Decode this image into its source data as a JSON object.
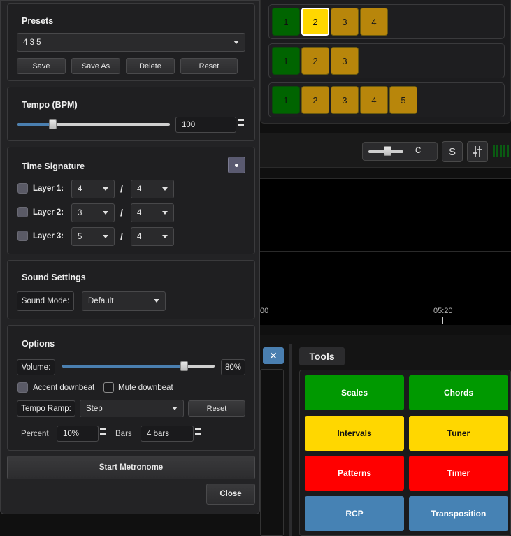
{
  "background": {
    "beat_rows": [
      {
        "beats": [
          {
            "label": "1",
            "state": "green"
          },
          {
            "label": "2",
            "state": "active"
          },
          {
            "label": "3",
            "state": "normal"
          },
          {
            "label": "4",
            "state": "normal"
          }
        ]
      },
      {
        "beats": [
          {
            "label": "1",
            "state": "green"
          },
          {
            "label": "2",
            "state": "normal"
          },
          {
            "label": "3",
            "state": "normal"
          }
        ]
      },
      {
        "beats": [
          {
            "label": "1",
            "state": "green"
          },
          {
            "label": "2",
            "state": "normal"
          },
          {
            "label": "3",
            "state": "normal"
          },
          {
            "label": "4",
            "state": "normal"
          },
          {
            "label": "5",
            "state": "normal"
          }
        ]
      }
    ],
    "mini_slider_label": "C",
    "s_button": "S",
    "mixer_icon": "sliders-icon",
    "timeline": {
      "tick_left": "00",
      "tick_right": "05:20"
    },
    "close_x": "×",
    "tools": {
      "title": "Tools",
      "buttons": [
        {
          "label": "Scales",
          "color": "#009900",
          "text": "#ffffff"
        },
        {
          "label": "Chords",
          "color": "#009900",
          "text": "#ffffff"
        },
        {
          "label": "Intervals",
          "color": "#ffd700",
          "text": "#111111"
        },
        {
          "label": "Tuner",
          "color": "#ffd700",
          "text": "#111111"
        },
        {
          "label": "Patterns",
          "color": "#ff0000",
          "text": "#ffffff"
        },
        {
          "label": "Timer",
          "color": "#ff0000",
          "text": "#ffffff"
        },
        {
          "label": "RCP",
          "color": "#4682b4",
          "text": "#ffffff"
        },
        {
          "label": "Transposition",
          "color": "#4682b4",
          "text": "#ffffff"
        }
      ]
    }
  },
  "presets": {
    "title": "Presets",
    "selected": "4 3 5",
    "buttons": {
      "save": "Save",
      "save_as": "Save As",
      "delete": "Delete",
      "reset": "Reset"
    }
  },
  "tempo": {
    "title": "Tempo (BPM)",
    "value": "100",
    "slider_fraction": 0.23
  },
  "time_signature": {
    "title": "Time Signature",
    "collapse_icon": "dot-icon",
    "separator": "/",
    "layers": [
      {
        "label": "Layer 1:",
        "numerator": "4",
        "denominator": "4"
      },
      {
        "label": "Layer 2:",
        "numerator": "3",
        "denominator": "4"
      },
      {
        "label": "Layer 3:",
        "numerator": "5",
        "denominator": "4"
      }
    ]
  },
  "sound": {
    "title": "Sound Settings",
    "mode_label": "Sound Mode:",
    "mode_value": "Default"
  },
  "options": {
    "title": "Options",
    "volume_label": "Volume:",
    "volume_value": "80%",
    "volume_fraction": 0.8,
    "accent_label": "Accent downbeat",
    "mute_label": "Mute downbeat",
    "ramp_label": "Tempo Ramp:",
    "ramp_value": "Step",
    "ramp_reset": "Reset",
    "percent_label": "Percent",
    "percent_value": "10%",
    "bars_label": "Bars",
    "bars_value": "4 bars"
  },
  "start_button": "Start Metronome",
  "close_button": "Close"
}
